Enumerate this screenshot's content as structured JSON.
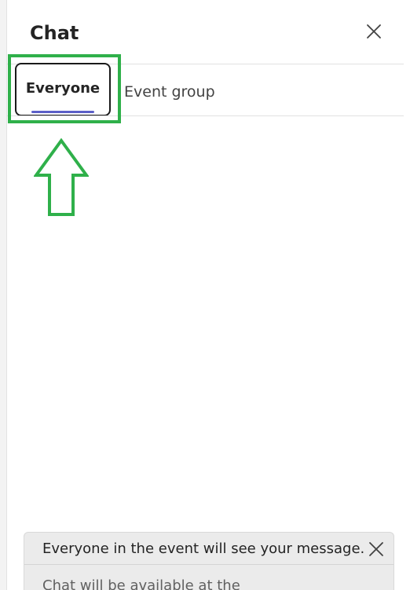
{
  "header": {
    "title": "Chat",
    "close_icon": "close-icon"
  },
  "tabs": [
    {
      "label": "Everyone",
      "selected": true
    },
    {
      "label": "Event group",
      "selected": false
    }
  ],
  "notice": {
    "message": "Everyone in the event will see your message.",
    "sub_message": "Chat will be available at the",
    "close_icon": "close-icon"
  },
  "colors": {
    "accent": "#5b5fc7",
    "annotation": "#2fb04a",
    "notice_bg": "#ebebeb"
  }
}
